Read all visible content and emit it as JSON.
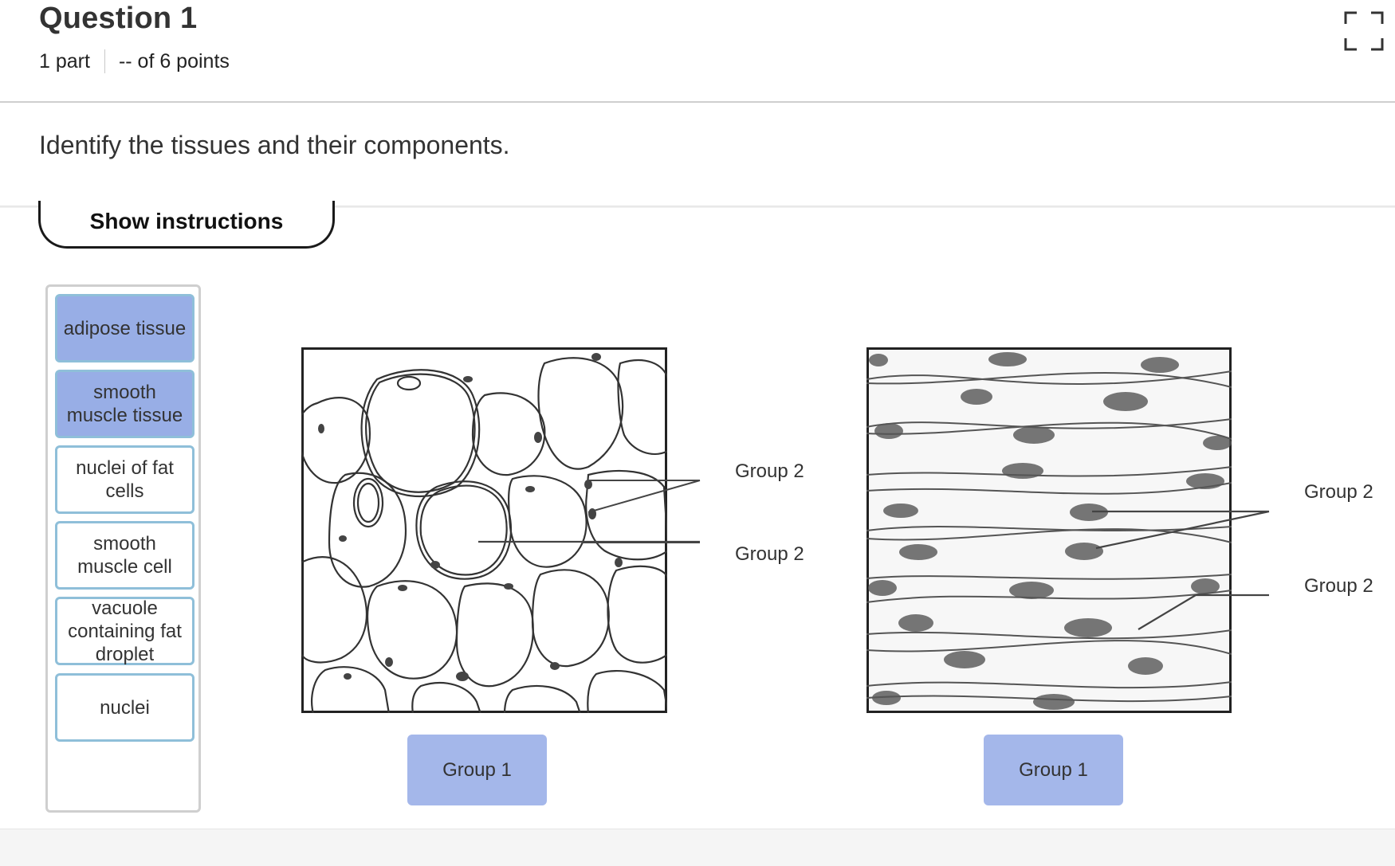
{
  "question": {
    "title": "Question 1",
    "parts": "1 part",
    "points": "-- of 6 points",
    "prompt": "Identify the tissues and their components."
  },
  "buttons": {
    "show_instructions": "Show instructions",
    "expand_icon": "fullscreen-expand-icon"
  },
  "word_bank": {
    "items": [
      {
        "label": "adipose tissue",
        "placed": true
      },
      {
        "label": "smooth muscle tissue",
        "placed": true
      },
      {
        "label": "nuclei of fat cells",
        "placed": false
      },
      {
        "label": "smooth muscle cell",
        "placed": false
      },
      {
        "label": "vacuole containing fat droplet",
        "placed": false
      },
      {
        "label": "nuclei",
        "placed": false
      }
    ]
  },
  "diagrams": [
    {
      "name": "adipose-tissue-diagram",
      "tissue_target": "Group 1",
      "pointer_labels": [
        "Group 2",
        "Group 2"
      ]
    },
    {
      "name": "smooth-muscle-diagram",
      "tissue_target": "Group 1",
      "pointer_labels": [
        "Group 2",
        "Group 2"
      ]
    }
  ],
  "colors": {
    "placed_chip": "#98aee6",
    "drop_target": "#a4b7ea",
    "chip_border": "#8fbfd9"
  }
}
